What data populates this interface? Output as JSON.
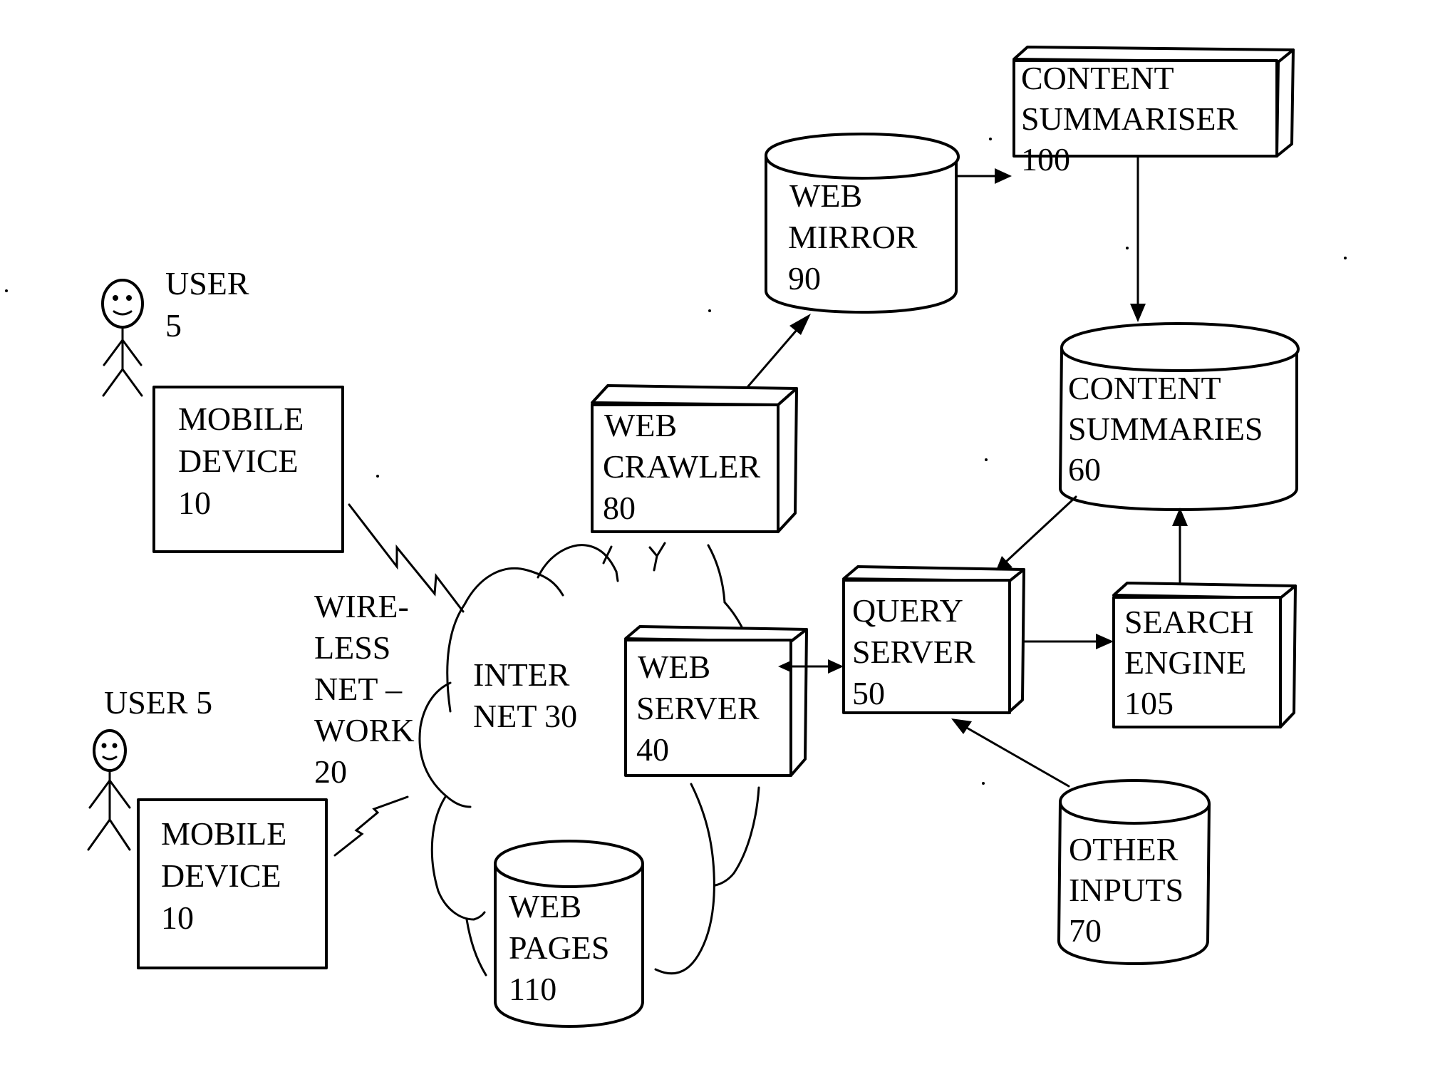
{
  "diagram": {
    "users": [
      {
        "id": "user-1",
        "label_lines": [
          "USER",
          "5"
        ]
      },
      {
        "id": "user-2",
        "label_lines": [
          "USER 5"
        ]
      }
    ],
    "mobile_devices": [
      {
        "id": "mobile-device-1",
        "label_lines": [
          "MOBILE",
          "DEVICE",
          "10"
        ]
      },
      {
        "id": "mobile-device-2",
        "label_lines": [
          "MOBILE",
          "DEVICE",
          "10"
        ]
      }
    ],
    "wireless_network": {
      "label_lines": [
        "WIRE-",
        "LESS",
        "NET –",
        "WORK",
        "20"
      ]
    },
    "internet": {
      "label_lines": [
        "INTER",
        "NET 30"
      ]
    },
    "web_crawler": {
      "label_lines": [
        "WEB",
        "CRAWLER",
        "80"
      ],
      "shape": "3d-box"
    },
    "web_mirror": {
      "label_lines": [
        "WEB",
        "MIRROR",
        "90"
      ],
      "shape": "cylinder"
    },
    "content_summariser": {
      "label_lines": [
        "CONTENT",
        "SUMMARISER",
        "100"
      ],
      "shape": "3d-box"
    },
    "content_summaries": {
      "label_lines": [
        "CONTENT",
        "SUMMARIES",
        "60"
      ],
      "shape": "cylinder"
    },
    "query_server": {
      "label_lines": [
        "QUERY",
        "SERVER",
        "50"
      ],
      "shape": "3d-box"
    },
    "search_engine": {
      "label_lines": [
        "SEARCH",
        "ENGINE",
        "105"
      ],
      "shape": "3d-box"
    },
    "web_server": {
      "label_lines": [
        "WEB",
        "SERVER",
        "40"
      ],
      "shape": "3d-box"
    },
    "other_inputs": {
      "label_lines": [
        "OTHER",
        "INPUTS",
        "70"
      ],
      "shape": "cylinder"
    },
    "web_pages": {
      "label_lines": [
        "WEB",
        "PAGES",
        "110"
      ],
      "shape": "cylinder"
    },
    "connections": [
      {
        "from": "mobile-device-1",
        "to": "internet",
        "type": "wireless-link"
      },
      {
        "from": "mobile-device-2",
        "to": "internet",
        "type": "wireless-link"
      },
      {
        "from": "web-crawler",
        "to": "web-mirror",
        "type": "arrow"
      },
      {
        "from": "web-mirror",
        "to": "content-summariser",
        "type": "arrow"
      },
      {
        "from": "content-summariser",
        "to": "content-summaries",
        "type": "arrow"
      },
      {
        "from": "content-summaries",
        "to": "query-server",
        "type": "arrow"
      },
      {
        "from": "search-engine",
        "to": "content-summaries",
        "type": "arrow"
      },
      {
        "from": "query-server",
        "to": "search-engine",
        "type": "arrow"
      },
      {
        "from": "other-inputs",
        "to": "query-server",
        "type": "arrow"
      },
      {
        "from": "web-server",
        "to": "query-server",
        "type": "bidirectional-arrow"
      }
    ]
  }
}
